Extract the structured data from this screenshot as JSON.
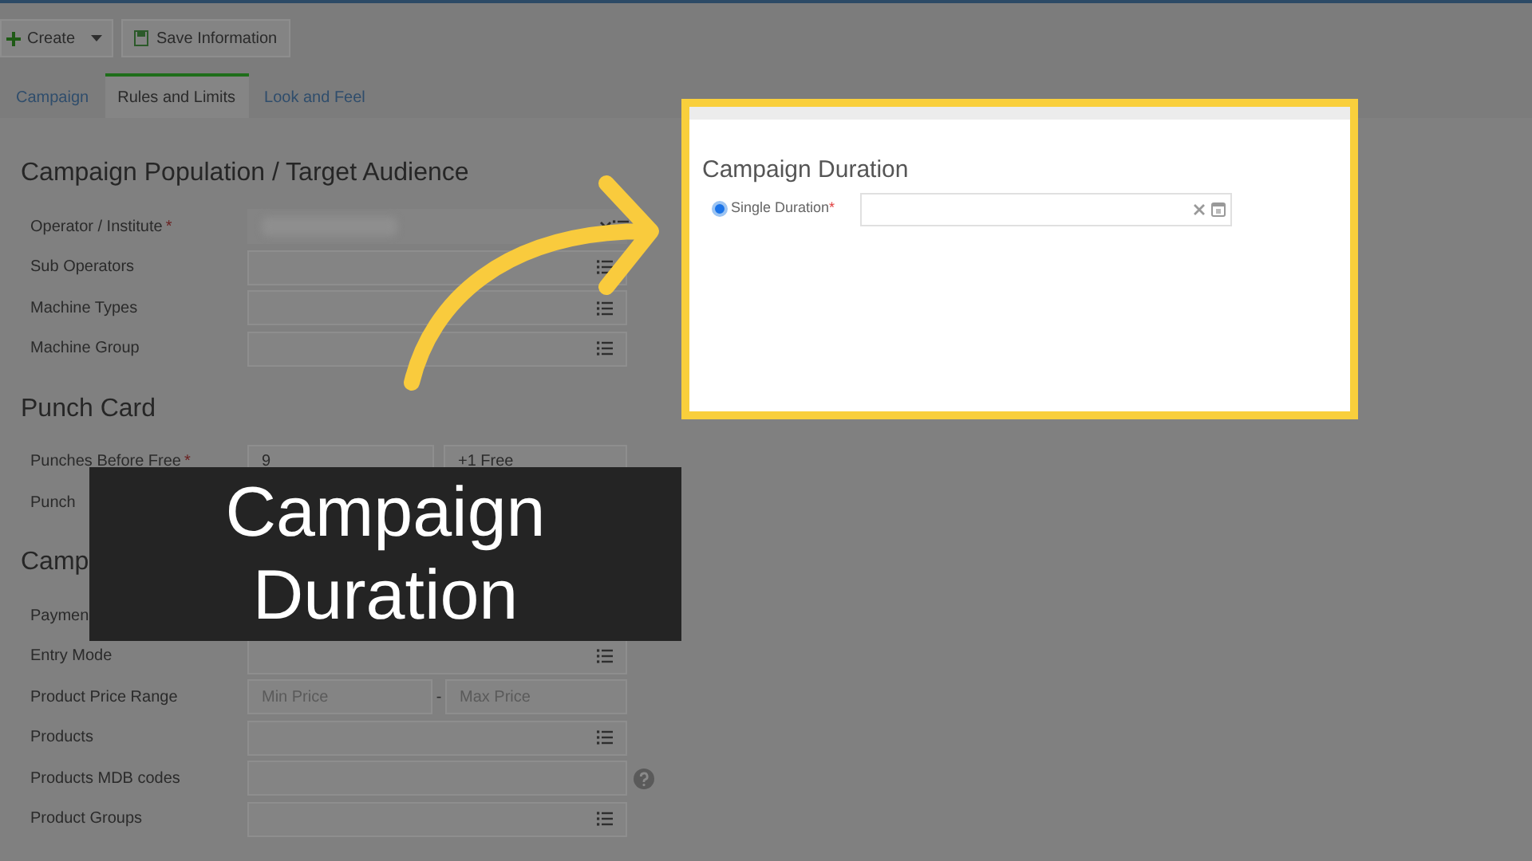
{
  "toolbar": [
    {
      "kind": "create",
      "label": "Create"
    },
    {
      "kind": "save",
      "label": "Save Information"
    }
  ],
  "tabs": [
    {
      "label": "Campaign",
      "selected": false
    },
    {
      "label": "Rules and Limits",
      "selected": true
    },
    {
      "label": "Look and Feel",
      "selected": false
    }
  ],
  "sections": [
    {
      "title": "Campaign Population / Target Audience",
      "rows": [
        {
          "kind": "blurred",
          "label": "Operator / Institute",
          "mark": "*"
        },
        {
          "kind": "list",
          "label": "Sub Operators"
        },
        {
          "kind": "list",
          "label": "Machine Types"
        },
        {
          "kind": "list",
          "label": "Machine Group"
        }
      ]
    },
    {
      "title": "Punch Card",
      "rows": [
        {
          "kind": "split",
          "label": "Punches Before Free",
          "mark": "*",
          "value": "9",
          "value_2": "+1 Free"
        },
        {
          "kind": "covered",
          "label": "Punch"
        }
      ]
    },
    {
      "title": "Camp",
      "rows": [
        {
          "kind": "covered",
          "label": "Paymen"
        },
        {
          "kind": "list",
          "label": "Entry Mode"
        },
        {
          "kind": "range",
          "label": "Product Price Range",
          "placeholder": "Min Price",
          "separator": "-",
          "placeholder_2": "Max Price"
        },
        {
          "kind": "list",
          "label": "Products"
        },
        {
          "kind": "help",
          "label": "Products MDB codes"
        },
        {
          "kind": "list",
          "label": "Product Groups"
        }
      ]
    }
  ],
  "callout": {
    "title": "Campaign Duration",
    "option": {
      "label": "Single Duration",
      "mark": "*",
      "selected": true
    }
  },
  "caption": "Campaign Duration"
}
